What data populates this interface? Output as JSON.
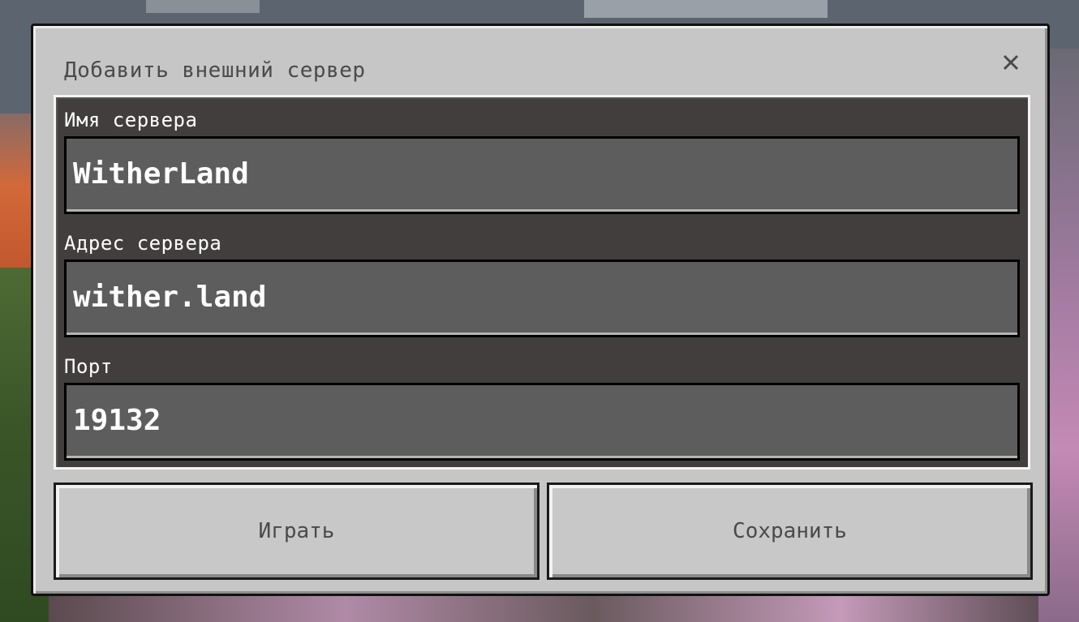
{
  "dialog": {
    "title": "Добавить внешний сервер",
    "close_icon": "close-icon"
  },
  "fields": {
    "server_name": {
      "label": "Имя сервера",
      "value": "WitherLand"
    },
    "server_address": {
      "label": "Адрес сервера",
      "value": "wither.land"
    },
    "port": {
      "label": "Порт",
      "value": "19132"
    }
  },
  "buttons": {
    "play_label": "Играть",
    "save_label": "Сохранить"
  },
  "colors": {
    "dialog_bg": "#c6c6c6",
    "input_bg": "#5d5d5d",
    "label_text": "#ffffff",
    "title_text": "#4a4a4a"
  }
}
